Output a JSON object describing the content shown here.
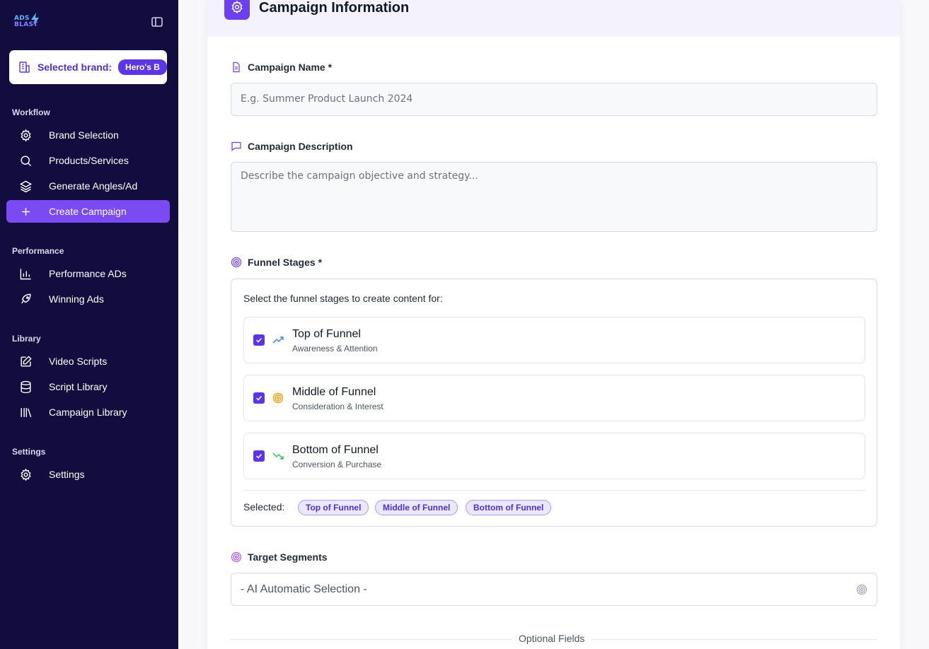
{
  "app": {
    "logo_line1": "ADS",
    "logo_line2": "BLAST"
  },
  "sidebar": {
    "brand_label": "Selected brand:",
    "brand_value": "Hero's B",
    "sections": {
      "workflow": "Workflow",
      "performance": "Performance",
      "library": "Library",
      "settings": "Settings"
    },
    "items": [
      {
        "label": "Brand Selection",
        "icon": "gear-icon"
      },
      {
        "label": "Products/Services",
        "icon": "search-icon"
      },
      {
        "label": "Generate Angles/Ad",
        "icon": "layers-icon"
      },
      {
        "label": "Create Campaign",
        "icon": "plus-icon",
        "active": true
      },
      {
        "label": "Performance ADs",
        "icon": "bar-chart-icon"
      },
      {
        "label": "Winning Ads",
        "icon": "rocket-icon"
      },
      {
        "label": "Video Scripts",
        "icon": "edit-icon"
      },
      {
        "label": "Script Library",
        "icon": "database-icon"
      },
      {
        "label": "Campaign Library",
        "icon": "library-icon"
      },
      {
        "label": "Settings",
        "icon": "gear-icon"
      }
    ]
  },
  "main": {
    "title": "Campaign Information",
    "campaign_name": {
      "label": "Campaign Name *",
      "placeholder": "E.g. Summer Product Launch 2024",
      "value": ""
    },
    "campaign_description": {
      "label": "Campaign Description",
      "placeholder": "Describe the campaign objective and strategy...",
      "value": ""
    },
    "funnel": {
      "label": "Funnel Stages *",
      "hint": "Select the funnel stages to create content for:",
      "stages": [
        {
          "title": "Top of Funnel",
          "subtitle": "Awareness & Attention",
          "checked": true,
          "icon": "trending-up-icon",
          "color": "#3b82f6"
        },
        {
          "title": "Middle of Funnel",
          "subtitle": "Consideration & Interest",
          "checked": true,
          "icon": "target-icon",
          "color": "#f59e0b"
        },
        {
          "title": "Bottom of Funnel",
          "subtitle": "Conversion & Purchase",
          "checked": true,
          "icon": "trending-down-icon",
          "color": "#22c55e"
        }
      ],
      "selected_label": "Selected:",
      "selected": [
        "Top of Funnel",
        "Middle of Funnel",
        "Bottom of Funnel"
      ]
    },
    "target_segments": {
      "label": "Target Segments",
      "value": "- AI Automatic Selection -"
    },
    "optional_fields": "Optional Fields"
  },
  "colors": {
    "sidebar_bg": "#120c3f",
    "accent": "#7a4af3",
    "brand_purple": "#5b36e6"
  }
}
